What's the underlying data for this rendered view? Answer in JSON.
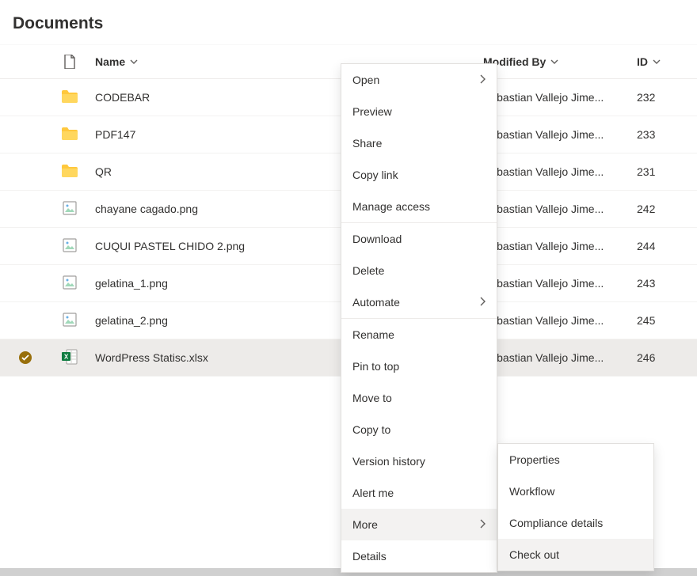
{
  "title": "Documents",
  "columns": {
    "name": "Name",
    "modifiedBy": "Modified By",
    "id": "ID"
  },
  "rows": [
    {
      "type": "folder",
      "name": "CODEBAR",
      "modifiedBy": "Sebastian Vallejo Jime...",
      "id": "232",
      "selected": false
    },
    {
      "type": "folder",
      "name": "PDF147",
      "modifiedBy": "Sebastian Vallejo Jime...",
      "id": "233",
      "selected": false
    },
    {
      "type": "folder",
      "name": "QR",
      "modifiedBy": "Sebastian Vallejo Jime...",
      "id": "231",
      "selected": false
    },
    {
      "type": "image",
      "name": "chayane cagado.png",
      "modifiedBy": "Sebastian Vallejo Jime...",
      "id": "242",
      "selected": false
    },
    {
      "type": "image",
      "name": "CUQUI PASTEL CHIDO 2.png",
      "modifiedBy": "Sebastian Vallejo Jime...",
      "id": "244",
      "selected": false
    },
    {
      "type": "image",
      "name": "gelatina_1.png",
      "modifiedBy": "Sebastian Vallejo Jime...",
      "id": "243",
      "selected": false
    },
    {
      "type": "image",
      "name": "gelatina_2.png",
      "modifiedBy": "Sebastian Vallejo Jime...",
      "id": "245",
      "selected": false
    },
    {
      "type": "excel",
      "name": "WordPress Statisc.xlsx",
      "modifiedBy": "Sebastian Vallejo Jime...",
      "id": "246",
      "selected": true
    }
  ],
  "menu": {
    "items": [
      {
        "label": "Open",
        "submenu": true
      },
      {
        "label": "Preview"
      },
      {
        "label": "Share"
      },
      {
        "label": "Copy link"
      },
      {
        "label": "Manage access"
      },
      {
        "sep": true
      },
      {
        "label": "Download"
      },
      {
        "label": "Delete"
      },
      {
        "label": "Automate",
        "submenu": true
      },
      {
        "sep": true
      },
      {
        "label": "Rename"
      },
      {
        "label": "Pin to top"
      },
      {
        "label": "Move to"
      },
      {
        "label": "Copy to"
      },
      {
        "label": "Version history"
      },
      {
        "label": "Alert me"
      },
      {
        "label": "More",
        "submenu": true,
        "hover": true
      },
      {
        "label": "Details"
      }
    ],
    "submenu": [
      {
        "label": "Properties"
      },
      {
        "label": "Workflow"
      },
      {
        "label": "Compliance details"
      },
      {
        "label": "Check out",
        "hover": true
      }
    ]
  }
}
